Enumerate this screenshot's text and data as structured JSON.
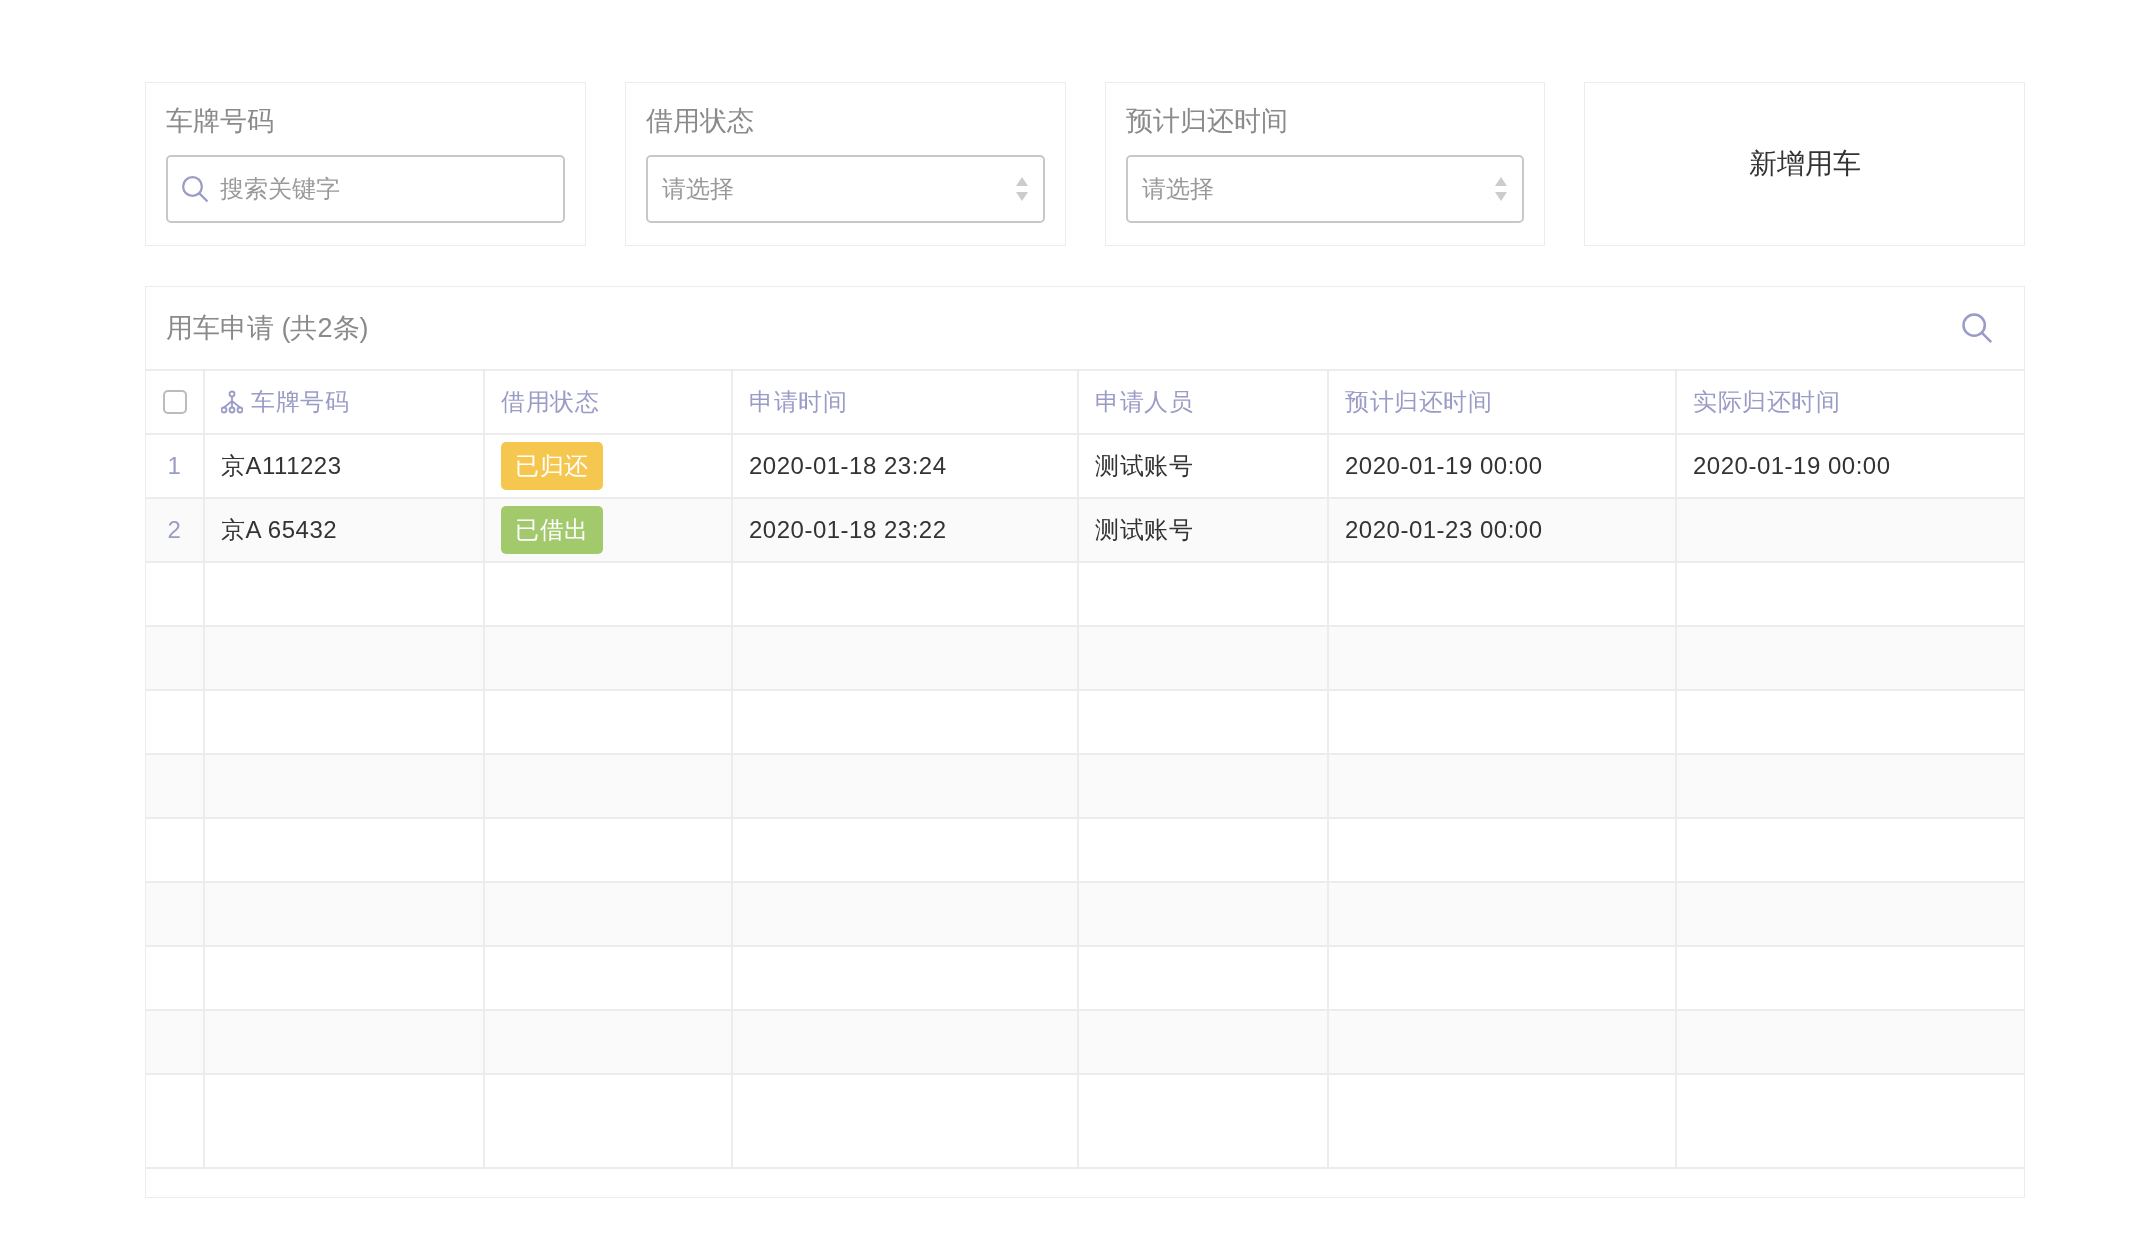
{
  "filters": [
    {
      "kind": "search",
      "label": "车牌号码",
      "placeholder": "搜索关键字"
    },
    {
      "kind": "select",
      "label": "借用状态",
      "placeholder": "请选择"
    },
    {
      "kind": "select",
      "label": "预计归还时间",
      "placeholder": "请选择"
    },
    {
      "kind": "action",
      "label": "新增用车"
    }
  ],
  "table": {
    "title": "用车申请 (共2条)",
    "select_all": {
      "checked": false
    },
    "columns": [
      "车牌号码",
      "借用状态",
      "申请时间",
      "申请人员",
      "预计归还时间",
      "实际归还时间"
    ],
    "rows": [
      {
        "index": "1",
        "plate": "京A111223",
        "status": {
          "label": "已归还",
          "color": "#f5c74e"
        },
        "applied": "2020-01-18 23:24",
        "applicant": "测试账号",
        "expected_return": "2020-01-19 00:00",
        "actual_return": "2020-01-19 00:00"
      },
      {
        "index": "2",
        "plate": "京A 65432",
        "status": {
          "label": "已借出",
          "color": "#a3c96d"
        },
        "applied": "2020-01-18 23:22",
        "applicant": "测试账号",
        "expected_return": "2020-01-23 00:00"
      }
    ]
  }
}
